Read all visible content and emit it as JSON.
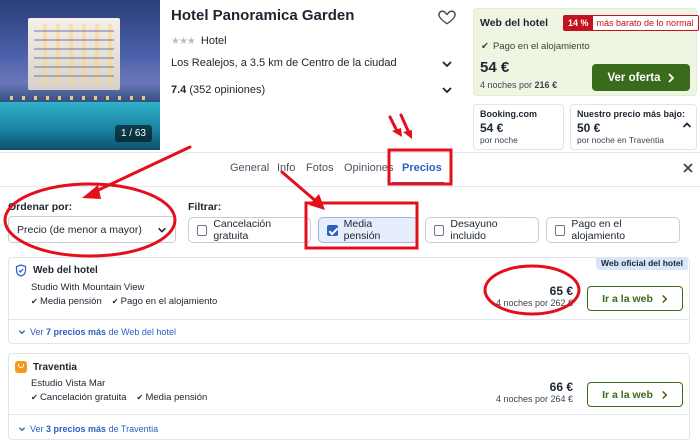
{
  "hotel": {
    "name": "Hotel Panoramica Garden",
    "type": "Hotel",
    "stars": "★★★",
    "location": "Los Realejos, a 3.5 km de Centro de la ciudad",
    "rating_score": "7.4",
    "rating_count": "(352 opiniones)",
    "photo_counter": "1 / 63"
  },
  "deal": {
    "provider": "Web del hotel",
    "badge_pct": "14 %",
    "badge_text": "más barato de lo normal",
    "payment": "Pago en el alojamiento",
    "price": "54 €",
    "nights_prefix": "4 noches por ",
    "nights_total": "216 €",
    "cta": "Ver oferta"
  },
  "compare": [
    {
      "name": "Booking.com",
      "price": "54 €",
      "sub": "por noche"
    },
    {
      "name": "Nuestro precio más bajo:",
      "price": "50 €",
      "sub": "por noche en Traventia"
    }
  ],
  "tabs": [
    {
      "label": "General"
    },
    {
      "label": "Info"
    },
    {
      "label": "Fotos"
    },
    {
      "label": "Opiniones"
    },
    {
      "label": "Precios"
    }
  ],
  "filters": {
    "sort_label": "Ordenar por:",
    "sort_value": "Precio (de menor a mayor)",
    "filter_label": "Filtrar:",
    "chips": [
      {
        "label": "Cancelación gratuita",
        "checked": false
      },
      {
        "label": "Media pensión",
        "checked": true
      },
      {
        "label": "Desayuno incluido",
        "checked": false
      },
      {
        "label": "Pago en el alojamiento",
        "checked": false
      }
    ]
  },
  "offers": [
    {
      "provider": "Web del hotel",
      "room": "Studio With Mountain View",
      "features": [
        "Media pensión",
        "Pago en el alojamiento"
      ],
      "price": "65 €",
      "nights": "4 noches por 262 €",
      "cta": "Ir a la web",
      "more_prefix": "Ver ",
      "more_bold": "7 precios más",
      "more_suffix": " de Web del hotel",
      "badge": "Web oficial del hotel"
    },
    {
      "provider": "Traventia",
      "room": "Estudio Vista Mar",
      "features": [
        "Cancelación gratuita",
        "Media pensión"
      ],
      "price": "66 €",
      "nights": "4 noches por 264 €",
      "cta": "Ir a la web",
      "more_prefix": "Ver ",
      "more_bold": "3 precios más",
      "more_suffix": " de Traventia"
    }
  ],
  "colors": {
    "accent_blue": "#2d5fc4",
    "cta_green": "#3a6b1d",
    "annotation_red": "#e3101b",
    "deal_bg": "#eef6e3"
  }
}
